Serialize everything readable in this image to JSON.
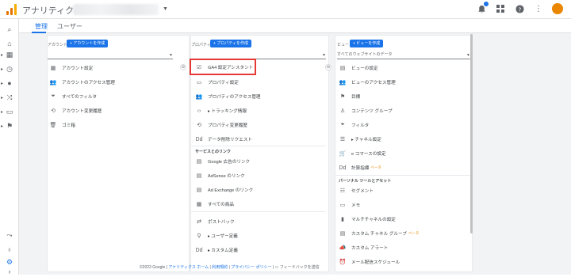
{
  "app": {
    "title": "アナリティクス"
  },
  "tabs": [
    {
      "label": "管理"
    },
    {
      "label": "ユーザー"
    }
  ],
  "account_col": {
    "label": "アカウント",
    "create": "+ アカウントを作成",
    "items": [
      {
        "icon": "building-icon",
        "glyph": "▦",
        "label": "アカウント設定"
      },
      {
        "icon": "users-icon",
        "glyph": "👥",
        "label": "アカウントのアクセス管理"
      },
      {
        "icon": "filter-icon",
        "glyph": "⏷",
        "label": "すべてのフィルタ"
      },
      {
        "icon": "history-icon",
        "glyph": "⟲",
        "label": "アカウント変更履歴"
      },
      {
        "icon": "trash-icon",
        "glyph": "🗑",
        "label": "ゴミ箱"
      }
    ]
  },
  "property_col": {
    "label": "プロパティ",
    "create": "+ プロパティを作成",
    "items": [
      {
        "icon": "checkbox-icon",
        "glyph": "☑",
        "label": "GA4 設定アシスタント"
      },
      {
        "icon": "property-icon",
        "glyph": "▭",
        "label": "プロパティ設定"
      },
      {
        "icon": "users-icon",
        "glyph": "👥",
        "label": "プロパティのアクセス管理"
      },
      {
        "icon": "code-icon",
        "glyph": "‹›",
        "label": "▸ トラッキング情報"
      },
      {
        "icon": "history-icon",
        "glyph": "⟲",
        "label": "プロパティ変更履歴"
      },
      {
        "icon": "dd-icon",
        "glyph": "Dd",
        "label": "データ削除リクエスト"
      }
    ],
    "section": "サービスとのリンク",
    "links": [
      {
        "icon": "google-ads-icon",
        "glyph": "▤",
        "label": "Google 広告のリンク"
      },
      {
        "icon": "adsense-icon",
        "glyph": "▤",
        "label": "AdSense のリンク"
      },
      {
        "icon": "adexchange-icon",
        "glyph": "▤",
        "label": "Ad Exchange のリンク"
      },
      {
        "icon": "products-icon",
        "glyph": "▦",
        "label": "すべての商品"
      },
      {
        "icon": "postback-icon",
        "glyph": "⇄",
        "label": "ポストバック"
      },
      {
        "icon": "custom-def-icon",
        "glyph": "⚲",
        "label": "▸ ユーザー定義"
      },
      {
        "icon": "dd-icon",
        "glyph": "Dd",
        "label": "▸ カスタム定義"
      }
    ]
  },
  "view_col": {
    "label": "ビュー",
    "create": "+ ビューを作成",
    "selected": "すべてのウェブサイトのデータ",
    "items": [
      {
        "icon": "document-icon",
        "glyph": "▤",
        "label": "ビューの設定"
      },
      {
        "icon": "users-icon",
        "glyph": "👥",
        "label": "ビューのアクセス管理"
      },
      {
        "icon": "flag-icon",
        "glyph": "⚑",
        "label": "目標"
      },
      {
        "icon": "content-group-icon",
        "glyph": "♙",
        "label": "コンテンツ グループ"
      },
      {
        "icon": "filter-icon",
        "glyph": "⏷",
        "label": "フィルタ"
      },
      {
        "icon": "channel-icon",
        "glyph": "☰",
        "label": "▸ チャネル設定"
      },
      {
        "icon": "cart-icon",
        "glyph": "🛒",
        "label": "e コマースの設定"
      },
      {
        "icon": "dd-icon",
        "glyph": "Dd",
        "label": "計算指標",
        "beta": "ベータ"
      }
    ],
    "section": "パーソナル ツールとアセット",
    "tools": [
      {
        "icon": "segment-icon",
        "glyph": "☷",
        "label": "セグメント"
      },
      {
        "icon": "memo-icon",
        "glyph": "▭",
        "label": "メモ"
      },
      {
        "icon": "bar-chart-icon",
        "glyph": "▮",
        "label": "マルチチャネルの設定"
      },
      {
        "icon": "channel-group-icon",
        "glyph": "▤",
        "label": "カスタム チャネル グループ",
        "beta": "ベータ"
      },
      {
        "icon": "alert-icon",
        "glyph": "📣",
        "label": "カスタム アラート"
      },
      {
        "icon": "schedule-icon",
        "glyph": "⏰",
        "label": "メール配信スケジュール"
      }
    ]
  },
  "footer": {
    "copyright": "©2023 Google",
    "home": "アナリティクス ホーム",
    "terms": "利用規約",
    "privacy": "プライバシー ポリシー",
    "feedback": "フィードバックを送信"
  }
}
